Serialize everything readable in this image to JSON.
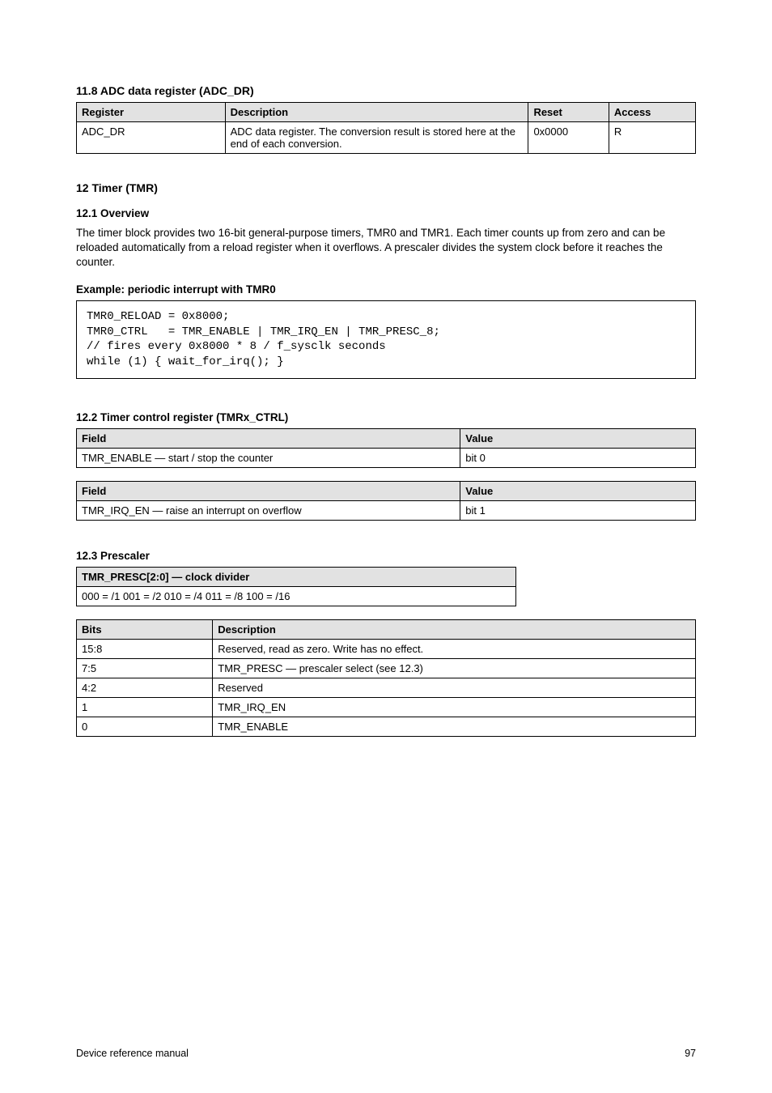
{
  "section11_8": {
    "title": "11.8 ADC data register (ADC_DR)",
    "table": {
      "headers": [
        "Register",
        "Description",
        "Reset",
        "Access"
      ],
      "row": {
        "reg": "ADC_DR",
        "desc": "ADC data register. The conversion result is stored here at the end of each conversion.",
        "reset": "0x0000",
        "access": "R"
      }
    }
  },
  "section12": {
    "title": "12 Timer (TMR)",
    "label_12_1": "12.1 Overview",
    "intro": "The timer block provides two 16-bit general-purpose timers, TMR0 and TMR1. Each timer counts up from zero and can be reloaded automatically from a reload register when it overflows. A prescaler divides the system clock before it reaches the counter.",
    "code_label": "Example: periodic interrupt with TMR0",
    "code": "TMR0_RELOAD = 0x8000;\nTMR0_CTRL   = TMR_ENABLE | TMR_IRQ_EN | TMR_PRESC_8;\n// fires every 0x8000 * 8 / f_sysclk seconds\nwhile (1) { wait_for_irq(); }",
    "label_12_2": "12.2 Timer control register (TMRx_CTRL)",
    "tableA": {
      "headers": [
        "Field",
        "Value"
      ],
      "row": {
        "field": "TMR_ENABLE — start / stop the counter",
        "value": "bit 0"
      }
    },
    "tableB": {
      "row": {
        "field": "TMR_IRQ_EN — raise an interrupt on overflow",
        "value": "bit 1"
      }
    },
    "label_12_3": "12.3 Prescaler",
    "prescaler_table": {
      "header": "TMR_PRESC[2:0] — clock divider",
      "row": "000 = /1   001 = /2   010 = /4   011 = /8   100 = /16"
    },
    "label_bits": "Bits",
    "bits_table": {
      "headers": [
        "Bits",
        "Description"
      ],
      "rows": [
        {
          "bits": "15:8",
          "desc": "Reserved, read as zero. Write has no effect."
        },
        {
          "bits": "7:5",
          "desc": "TMR_PRESC — prescaler select (see 12.3)"
        },
        {
          "bits": "4:2",
          "desc": "Reserved"
        },
        {
          "bits": "1",
          "desc": "TMR_IRQ_EN"
        },
        {
          "bits": "0",
          "desc": "TMR_ENABLE"
        }
      ]
    }
  },
  "footer": {
    "left": "Device reference manual",
    "right": "97"
  }
}
